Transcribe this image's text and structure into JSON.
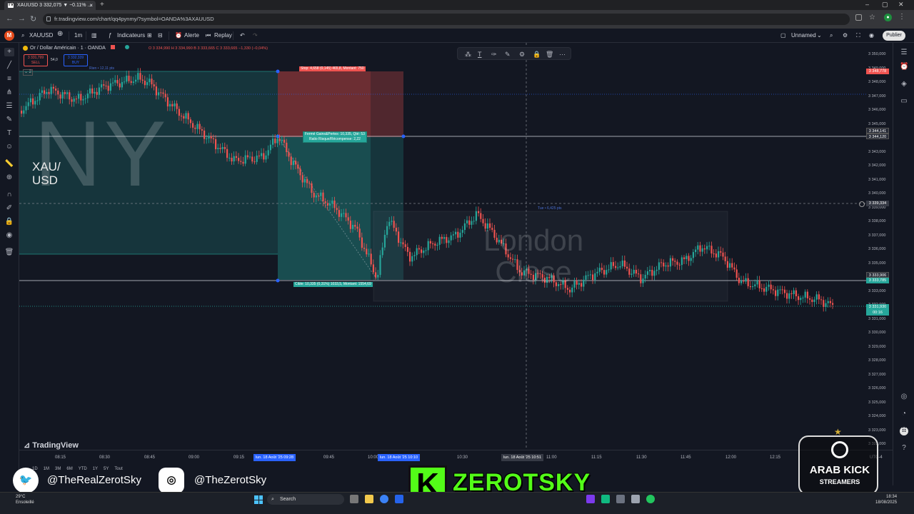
{
  "browser": {
    "tab_title": "XAUUSD 3 332,075 ▼ −0.11% ...",
    "tab_favicon": "TV",
    "new_tab": "+",
    "url": "fr.tradingview.com/chart/qq4pynmy/?symbol=OANDA%3AXAUUSD",
    "profile_initial": "●"
  },
  "toolbar": {
    "symbol": "XAUUSD",
    "interval": "1m",
    "indicators": "Indicateurs",
    "alert": "Alerte",
    "replay": "Replay",
    "layout_name": "Unnamed",
    "publish": "Publier"
  },
  "legend": {
    "title": "Or / Dollar Américain · 1 · OANDA",
    "ohlc": "O 3 334,990  H 3 334,990  B 3 333,665  C 3 333,665  −1,330 (−0,04%)",
    "sell_price": "3 331,799",
    "sell_label": "SELL",
    "spread": "54,0",
    "buy_price": "3 332,339",
    "buy_label": "BUY"
  },
  "chart": {
    "watermark_ny": "NY",
    "xau_label": "XAU/\nUSD",
    "london_label": "London\nClose",
    "stop_tag": "Stop: 4,658 (0,145) 465,8, Montant: 750",
    "pnl_tag_1": "Fermé Gains&Pertes: 10,335, Qté: 53",
    "pnl_tag_2": "Ratio Risque/Récompense: 2,22",
    "target_tag": "Cible: 10,335 (0,31%) 1033,5, Montant: 1554,69",
    "range_tag": "Rien • 12,11 pts",
    "cursor_tag": "Tue • 6,425 pts",
    "tradingview_logo": "TradingView"
  },
  "price_axis": {
    "labels": [
      "3 350,000",
      "3 349,000",
      "3 348,000",
      "3 347,000",
      "3 346,000",
      "3 345,000",
      "3 344,000",
      "3 343,000",
      "3 342,000",
      "3 341,000",
      "3 340,000",
      "3 339,000",
      "3 338,000",
      "3 337,000",
      "3 336,000",
      "3 335,000",
      "3 334,000",
      "3 333,000",
      "3 332,000",
      "3 331,000",
      "3 330,000",
      "3 329,000",
      "3 328,000",
      "3 327,000",
      "3 326,000",
      "3 325,000",
      "3 324,000",
      "3 323,000",
      "3 322,000"
    ],
    "stop_price": "3 348,778",
    "entry_price_1": "3 344,141",
    "entry_price_2": "3 344,120",
    "cursor_price": "3 339,334",
    "target_price_1": "3 333,906",
    "target_price_2": "3 333,785",
    "current_price": "3 331,930",
    "current_time": "00:16"
  },
  "time_axis": {
    "labels": [
      "08:15",
      "08:30",
      "08:45",
      "09:00",
      "09:15",
      "09:45",
      "10:00",
      "10:30",
      "10:45",
      "11:00",
      "11:15",
      "11:30",
      "11:45",
      "12:00",
      "12:15"
    ],
    "highlight_1": "lun. 18 Août '25  09:28",
    "highlight_2": "lun. 18 Août '25  10:10",
    "highlight_3": "lun. 18 Août '25  10:51",
    "range_buttons": [
      "1D",
      "1M",
      "3M",
      "6M",
      "YTD",
      "1Y",
      "5Y",
      "Tout"
    ],
    "tz": "UTC-4"
  },
  "overlay": {
    "twitter_handle": "@TheRealZerotSky",
    "instagram_handle": "@TheZerotSky",
    "k_logo": "K",
    "brand": "ZEROTSKY",
    "badge_line1": "ARAB KICK",
    "badge_line2": "STREAMERS"
  },
  "taskbar": {
    "weather_temp": "29°C",
    "weather_desc": "Ensoleillé",
    "search": "Search",
    "time": "18:34",
    "date": "18/08/2025"
  },
  "colors": {
    "background": "#131722",
    "up": "#26a69a",
    "down": "#ef5350",
    "stop_zone": "#ef5350",
    "target_zone": "#26a69a",
    "kick_green": "#53fc18"
  }
}
